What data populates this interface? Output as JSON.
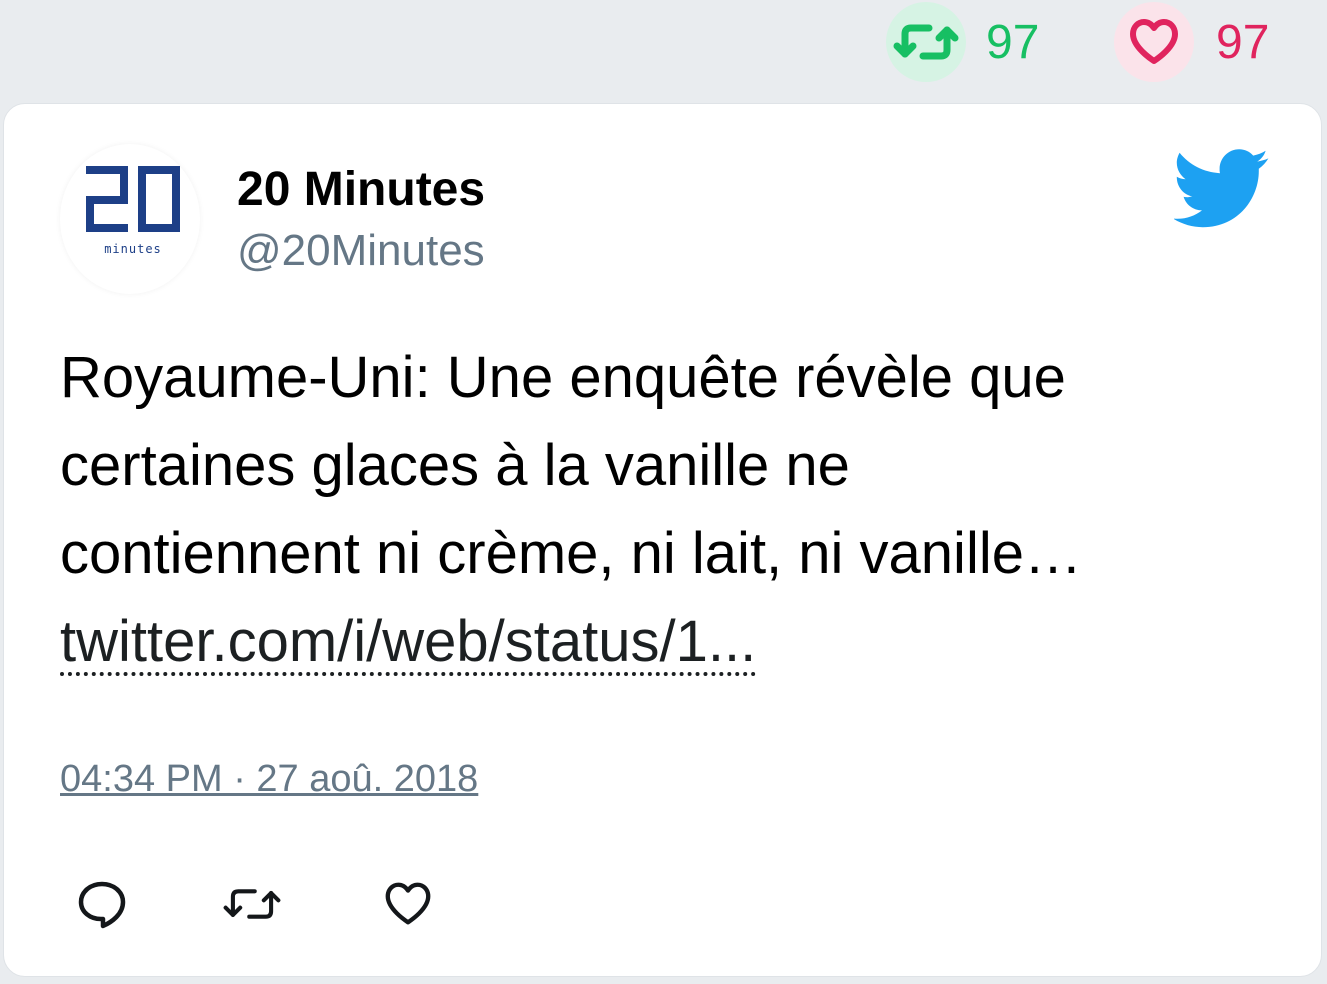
{
  "stats": {
    "retweets": "97",
    "likes": "97",
    "retweet_icon": "retweet-icon",
    "like_icon": "heart-icon",
    "retweet_color": "#17bf63",
    "like_color": "#e0245e"
  },
  "tweet": {
    "author_name": "20 Minutes",
    "author_handle": "@20Minutes",
    "avatar_logo_text": "20 minutes",
    "text_lines": [
      "Royaume-Uni: Une enquête révèle que",
      "certaines glaces à la vanille ne",
      "contiennent ni crème, ni lait, ni vanille…"
    ],
    "link": "twitter.com/i/web/status/1...",
    "timestamp": "04:34 PM · 27 aoû. 2018",
    "brand_icon": "twitter-bird-icon",
    "brand_color": "#1da1f2"
  },
  "actions": {
    "reply_icon": "reply-icon",
    "retweet_icon": "retweet-icon",
    "like_icon": "heart-icon"
  }
}
